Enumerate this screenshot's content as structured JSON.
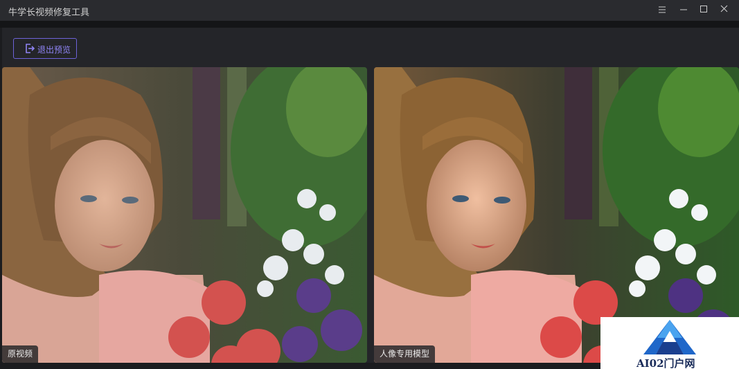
{
  "window": {
    "title": "牛学长视频修复工具",
    "controls": {
      "menu_icon": "menu-icon",
      "minimize_icon": "minimize-icon",
      "maximize_icon": "maximize-icon",
      "close_icon": "close-icon"
    }
  },
  "toolbar": {
    "exit_preview_label": "退出预览",
    "exit_icon": "exit-icon"
  },
  "preview": {
    "left_label": "原视频",
    "right_label": "人像专用模型"
  },
  "watermark": {
    "text": "AI02门户网",
    "logo": "triangle-logo"
  },
  "colors": {
    "accent": "#6e63d9",
    "accent_text": "#8f84f5",
    "background": "#242529",
    "titlebar": "#2a2b2f"
  }
}
